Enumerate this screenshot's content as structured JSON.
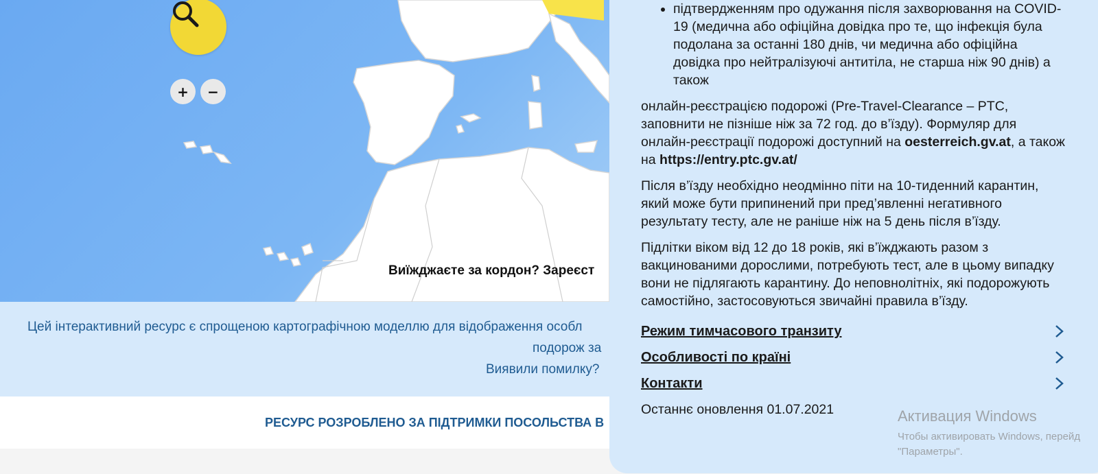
{
  "map": {
    "prompt": "Виїжджаєте за кордон? Зареєст"
  },
  "controls": {
    "zoom_in": "+",
    "zoom_out": "−"
  },
  "info": {
    "line1": "Цей інтерактивний ресурс є спрощеною картографічною моделлю для відображення особл",
    "line2": "подорож за",
    "error_link": "Виявили помилку?"
  },
  "credit": "РЕСУРС РОЗРОБЛЕНО ЗА ПІДТРИМКИ ПОСОЛЬСТВА В",
  "panel": {
    "bullets": [
      "підтвердженням про одужання після захворювання на COVID-19 (медична або офіційна довідка про те, що інфекція була подолана за останні 180 днів, чи медична або офіційна довідка про нейтралізуючі антитіла, не старша ніж 90 днів) а також"
    ],
    "para1": {
      "text1": "онлайн-реєстрацією подорожі (Pre-Travel-Clearance – PTC, заповнити не пізніше ніж за 72 год. до в’їзду). Формуляр для онлайн-реєстрації подорожі доступний на ",
      "bold1": "oesterreich.gv.at",
      "text2": ", а також на ",
      "bold2": "https://entry.ptc.gv.at/"
    },
    "para2": "Після в’їзду необхідно неодмінно піти на 10-тиденний карантин, який може бути припинений при пред’явленні негативного результату тесту, але не раніше ніж на 5 день після в’їзду.",
    "para3": "Підлітки віком від 12 до 18 років, які в’їжджають разом з вакцинованими дорослими, потребують тест, але в цьому випадку вони не підлягають карантину. До неповнолітніх, які подорожують самостійно, застосовуються звичайні правила в’їзду.",
    "links": [
      "Режим тимчасового транзиту",
      "Особливості по країні",
      "Контакти"
    ],
    "updated": "Останнє оновлення 01.07.2021"
  },
  "watermark": {
    "title": "Активация Windows",
    "line1": "Чтобы активировать Windows, перейд",
    "line2": "\"Параметры\"."
  },
  "colors": {
    "accent_yellow": "#f2d835",
    "panel_bg": "#d6e9fb",
    "link_blue": "#1f5b91",
    "chevron": "#1f5b91"
  }
}
